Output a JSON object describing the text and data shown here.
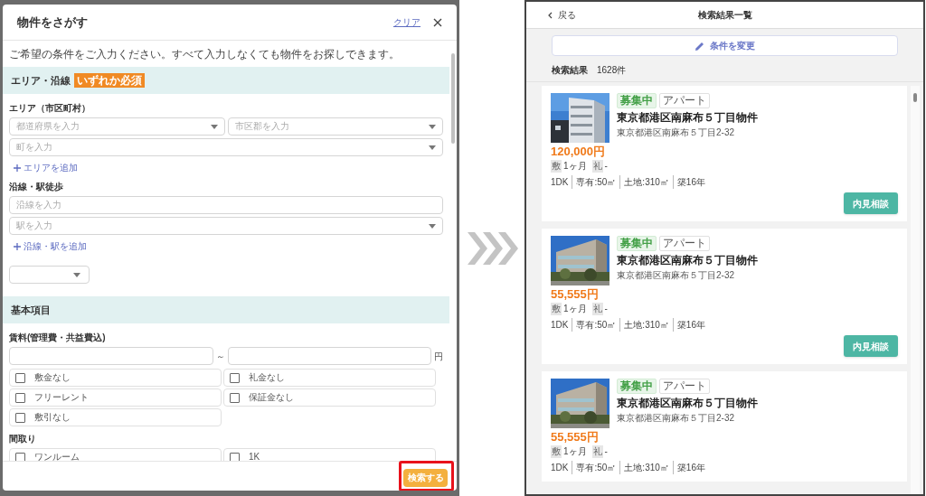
{
  "search_modal": {
    "title": "物件をさがす",
    "clear_link": "クリア",
    "description": "ご希望の条件をご入力ください。すべて入力しなくても物件をお探しできます。",
    "sections": [
      {
        "title": "エリア・沿線",
        "badge": "いずれか必須",
        "groups": [
          {
            "label": "エリア（市区町村）",
            "rows": [
              [
                {
                  "kind": "select",
                  "placeholder": "都道府県を入力"
                },
                {
                  "kind": "select",
                  "placeholder": "市区郡を入力"
                }
              ],
              [
                {
                  "kind": "select",
                  "placeholder": "町を入力"
                }
              ]
            ],
            "add_link": "エリアを追加"
          },
          {
            "label": "沿線・駅徒歩",
            "rows": [
              [
                {
                  "kind": "input",
                  "placeholder": "沿線を入力"
                }
              ],
              [
                {
                  "kind": "select",
                  "placeholder": "駅を入力"
                }
              ]
            ],
            "add_link": "沿線・駅を追加"
          },
          {
            "rows": [
              [
                {
                  "kind": "small-select"
                }
              ]
            ]
          }
        ]
      },
      {
        "title": "基本項目",
        "groups": [
          {
            "label": "賃料(管理費・共益費込)",
            "range": {
              "separator": "～",
              "unit": "円"
            },
            "checkboxes": [
              {
                "label": "敷金なし",
                "checked": false
              },
              {
                "label": "礼金なし",
                "checked": false
              },
              {
                "label": "フリーレント",
                "checked": false
              },
              {
                "label": "保証金なし",
                "checked": false
              },
              {
                "label": "敷引なし",
                "checked": false
              }
            ]
          },
          {
            "label": "間取り",
            "checkboxes": [
              {
                "label": "ワンルーム",
                "checked": false
              },
              {
                "label": "1K",
                "checked": false
              }
            ]
          }
        ]
      }
    ],
    "submit_button": "検索する"
  },
  "results_screen": {
    "back_link": "戻る",
    "title": "検索結果一覧",
    "change_button": "条件を変更",
    "results_label": "検索結果",
    "results_count": "1628件",
    "listings": [
      {
        "tags": [
          {
            "label": "募集中",
            "kind": "status"
          },
          {
            "label": "アパート",
            "kind": "type"
          }
        ],
        "name": "東京都港区南麻布５丁目物件",
        "address": "東京都港区南麻布５丁目2-32",
        "price": "120,000円",
        "deposit_label": "敷",
        "deposit": "1ヶ月",
        "key_money_label": "礼",
        "key_money": "-",
        "specs": [
          "1DK",
          "専有:50㎡",
          "土地:310㎡",
          "築16年"
        ],
        "button": "内見相談"
      },
      {
        "tags": [
          {
            "label": "募集中",
            "kind": "status"
          },
          {
            "label": "アパート",
            "kind": "type"
          }
        ],
        "name": "東京都港区南麻布５丁目物件",
        "address": "東京都港区南麻布５丁目2-32",
        "price": "55,555円",
        "deposit_label": "敷",
        "deposit": "1ヶ月",
        "key_money_label": "礼",
        "key_money": "-",
        "specs": [
          "1DK",
          "専有:50㎡",
          "土地:310㎡",
          "築16年"
        ],
        "button": "内見相談"
      },
      {
        "tags": [
          {
            "label": "募集中",
            "kind": "status"
          },
          {
            "label": "アパート",
            "kind": "type"
          }
        ],
        "name": "東京都港区南麻布５丁目物件",
        "address": "東京都港区南麻布５丁目2-32",
        "price": "55,555円",
        "deposit_label": "敷",
        "deposit": "1ヶ月",
        "key_money_label": "礼",
        "key_money": "-",
        "specs": [
          "1DK",
          "専有:50㎡",
          "土地:310㎡",
          "築16年"
        ]
      }
    ]
  }
}
